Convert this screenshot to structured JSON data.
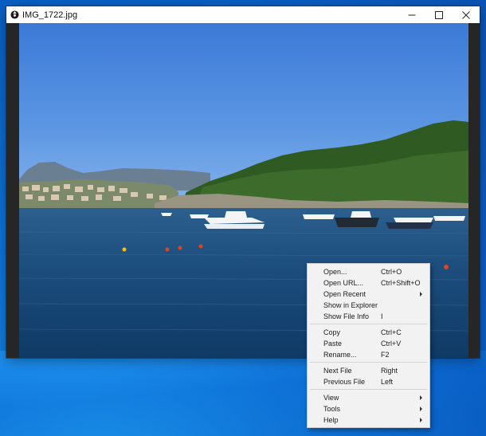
{
  "window": {
    "title": "IMG_1722.jpg",
    "app_icon": "camera-lens-icon",
    "controls": [
      "minimize-icon",
      "maximize-icon",
      "close-icon"
    ]
  },
  "context_menu": {
    "groups": [
      [
        {
          "label": "Open...",
          "shortcut": "Ctrl+O"
        },
        {
          "label": "Open URL...",
          "shortcut": "Ctrl+Shift+O"
        },
        {
          "label": "Open Recent",
          "submenu": true
        },
        {
          "label": "Show in Explorer"
        },
        {
          "label": "Show File Info",
          "shortcut": "I"
        }
      ],
      [
        {
          "label": "Copy",
          "shortcut": "Ctrl+C"
        },
        {
          "label": "Paste",
          "shortcut": "Ctrl+V"
        },
        {
          "label": "Rename...",
          "shortcut": "F2"
        }
      ],
      [
        {
          "label": "Next File",
          "shortcut": "Right"
        },
        {
          "label": "Previous File",
          "shortcut": "Left"
        }
      ],
      [
        {
          "label": "View",
          "submenu": true
        },
        {
          "label": "Tools",
          "submenu": true
        },
        {
          "label": "Help",
          "submenu": true
        }
      ]
    ]
  },
  "colors": {
    "desktop": "#0b5fc4",
    "viewer_background": "#262626",
    "menu_background": "#f2f2f2"
  }
}
